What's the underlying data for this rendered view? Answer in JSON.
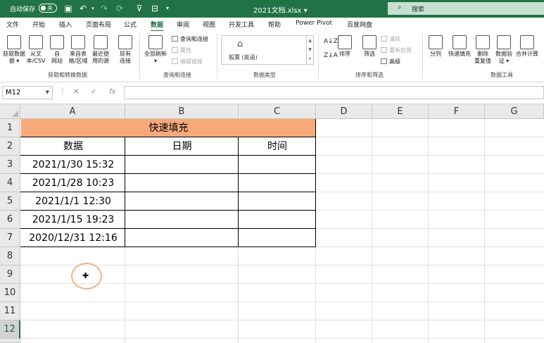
{
  "titlebar": {
    "autosave_label": "自动保存",
    "autosave_state": "关",
    "doc_title": "2021文档.xlsx ▾",
    "search_placeholder": "搜索"
  },
  "tabs": [
    "文件",
    "开始",
    "插入",
    "页面布局",
    "公式",
    "数据",
    "审阅",
    "视图",
    "开发工具",
    "帮助",
    "Power Pivot",
    "百度网盘"
  ],
  "active_tab": "数据",
  "ribbon": {
    "get_data": "获取数据",
    "get_data_sub": "据 ▾",
    "from_text": "从文",
    "from_text_sub": "本/CSV",
    "from_web": "自",
    "from_web_sub": "网站",
    "from_table": "来自表",
    "from_table_sub": "格/区域",
    "recent_sources": "最近使",
    "recent_sources_sub": "用的源",
    "existing_conn": "现有",
    "existing_conn_sub": "连接",
    "group_get_transform": "获取和转换数据",
    "refresh_all": "全部刷新",
    "refresh_all_sub": "▾",
    "queries_conn": "查询和连接",
    "properties": "属性",
    "edit_links": "编辑链接",
    "group_queries": "查询和连接",
    "data_type_stock": "股票 (英语)",
    "group_data_types": "数据类型",
    "sort": "排序",
    "filter": "筛选",
    "clear": "清除",
    "reapply": "重新应用",
    "advanced": "高级",
    "group_sort_filter": "排序和筛选",
    "text_to_columns": "分列",
    "flash_fill": "快速填充",
    "remove_dup": "删除",
    "remove_dup_sub": "重复值",
    "data_validation": "数据验",
    "data_validation_sub": "证 ▾",
    "consolidate": "合并计算",
    "group_data_tools": "数据工具"
  },
  "formula_bar": {
    "name_box": "M12",
    "cancel": "✕",
    "enter": "✓",
    "fx": "fx",
    "value": ""
  },
  "sheet": {
    "columns": [
      "A",
      "B",
      "C",
      "D",
      "E",
      "F",
      "G"
    ],
    "rows": [
      "1",
      "2",
      "3",
      "4",
      "5",
      "6",
      "7",
      "8",
      "9",
      "10",
      "11",
      "12"
    ],
    "selected_row": "12",
    "title": "快速填充",
    "headers": [
      "数据",
      "日期",
      "时间"
    ],
    "data": [
      [
        "2021/1/30 15:32",
        "",
        ""
      ],
      [
        "2021/1/28 10:23",
        "",
        ""
      ],
      [
        "2021/1/1 12:30",
        "",
        ""
      ],
      [
        "2021/1/15 19:23",
        "",
        ""
      ],
      [
        "2020/12/31 12:16",
        "",
        ""
      ]
    ],
    "title_fill": "#f8a97a"
  },
  "colors": {
    "excel_green": "#217346",
    "cursor_ring": "#f4b27c"
  }
}
